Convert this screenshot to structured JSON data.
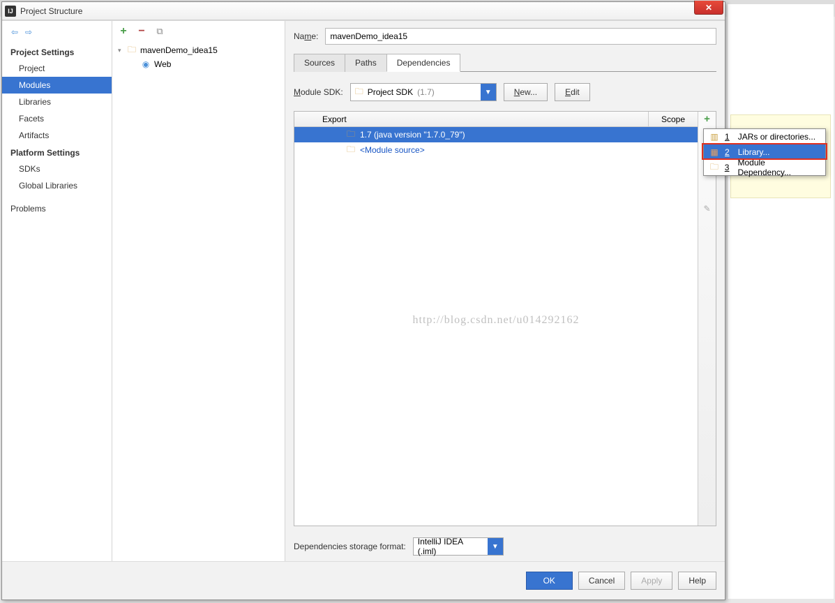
{
  "window": {
    "title": "Project Structure"
  },
  "nav": {
    "section1": "Project Settings",
    "items1": [
      "Project",
      "Modules",
      "Libraries",
      "Facets",
      "Artifacts"
    ],
    "selected1": "Modules",
    "section2": "Platform Settings",
    "items2": [
      "SDKs",
      "Global Libraries"
    ],
    "section3": "Problems"
  },
  "tree": {
    "module_name": "mavenDemo_idea15",
    "facet": "Web"
  },
  "main": {
    "name_label": "Name:",
    "name_value": "mavenDemo_idea15",
    "tabs": [
      "Sources",
      "Paths",
      "Dependencies"
    ],
    "active_tab": "Dependencies",
    "sdk_label": "Module SDK:",
    "sdk_value": "Project SDK",
    "sdk_version": "(1.7)",
    "new_btn": "New...",
    "edit_btn": "Edit",
    "table": {
      "col_export": "Export",
      "col_scope": "Scope",
      "rows": [
        {
          "text": "1.7 (java version \"1.7.0_79\")",
          "selected": true,
          "icon": "folder"
        },
        {
          "text": "<Module source>",
          "selected": false,
          "icon": "folder",
          "class": "module-src"
        }
      ]
    },
    "watermark": "http://blog.csdn.net/u014292162",
    "storage_label": "Dependencies storage format:",
    "storage_value": "IntelliJ IDEA (.iml)"
  },
  "popup": {
    "items": [
      {
        "key": "1",
        "label": "JARs or directories...",
        "icon": "jars"
      },
      {
        "key": "2",
        "label": "Library...",
        "icon": "library",
        "selected": true
      },
      {
        "key": "3",
        "label": "Module Dependency...",
        "icon": "module"
      }
    ]
  },
  "buttons": {
    "ok": "OK",
    "cancel": "Cancel",
    "apply": "Apply",
    "help": "Help"
  }
}
